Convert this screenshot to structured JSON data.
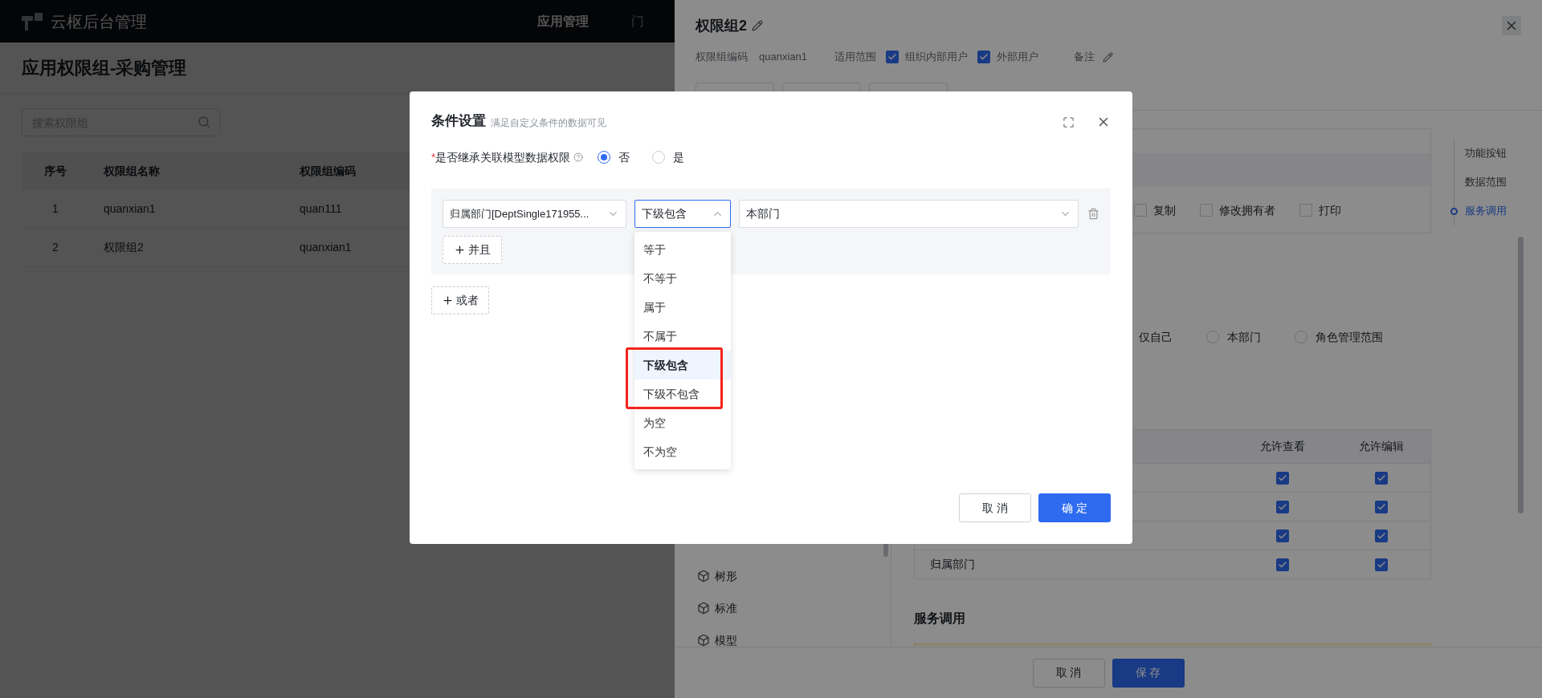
{
  "top_bar": {
    "title": "云枢后台管理",
    "nav": [
      {
        "label": "应用管理",
        "selected": true
      },
      {
        "label": "门",
        "selected": false
      }
    ]
  },
  "page": {
    "title": "应用权限组-采购管理",
    "search": {
      "placeholder": "搜索权限组"
    },
    "table": {
      "columns": [
        "序号",
        "权限组名称",
        "权限组编码"
      ],
      "rows": [
        [
          "1",
          "quanxian1",
          "quan111"
        ],
        [
          "2",
          "权限组2",
          "quanxian1"
        ]
      ]
    }
  },
  "drawer": {
    "title": "权限组2",
    "meta": {
      "code_label": "权限组编码",
      "code_value": "quanxian1",
      "scope_label": "适用范围",
      "scopes": [
        {
          "label": "组织内部用户",
          "checked": true
        },
        {
          "label": "外部用户",
          "checked": true
        }
      ],
      "remark_label": "备注"
    },
    "function_buttons": [
      {
        "label": "复制",
        "checked": false
      },
      {
        "label": "修改拥有者",
        "checked": false
      },
      {
        "label": "打印",
        "checked": false
      }
    ],
    "data_scope": [
      {
        "label": "仅自己"
      },
      {
        "label": "本部门",
        "selected": false
      },
      {
        "label": "角色管理范围",
        "selected": false
      }
    ],
    "field_table": {
      "columns": [
        "允许查看",
        "允许编辑"
      ],
      "rows": [
        {
          "view": true,
          "edit": true
        },
        {
          "view": true,
          "edit": true
        },
        {
          "view": true,
          "edit": true
        },
        {
          "label": "归属部门",
          "view": true,
          "edit": true
        }
      ]
    },
    "service_heading": "服务调用",
    "anchors": [
      {
        "label": "功能按钮",
        "selected": false
      },
      {
        "label": "数据范围",
        "selected": false
      },
      {
        "label": "服务调用",
        "selected": true
      }
    ],
    "sidebar": [
      {
        "label": "树形"
      },
      {
        "label": "标准"
      },
      {
        "label": "模型"
      }
    ],
    "footer": {
      "cancel": "取 消",
      "save": "保 存"
    }
  },
  "modal": {
    "title": "条件设置",
    "subtitle": "满足自定义条件的数据可见",
    "inherit": {
      "label": "是否继承关联模型数据权限",
      "required_mark": "*",
      "options": [
        {
          "label": "否",
          "selected": true
        },
        {
          "label": "是",
          "selected": false
        }
      ]
    },
    "condition": {
      "field": "归属部门[DeptSingle171955...",
      "operator": "下级包含",
      "value": "本部门",
      "operator_open": true
    },
    "and_button": "并且",
    "or_button": "或者",
    "operator_options": [
      {
        "label": "等于",
        "selected": false
      },
      {
        "label": "不等于",
        "selected": false
      },
      {
        "label": "属于",
        "selected": false
      },
      {
        "label": "不属于",
        "selected": false
      },
      {
        "label": "下级包含",
        "selected": true
      },
      {
        "label": "下级不包含",
        "selected": false
      },
      {
        "label": "为空",
        "selected": false
      },
      {
        "label": "不为空",
        "selected": false
      }
    ],
    "buttons": {
      "cancel": "取 消",
      "ok": "确 定"
    }
  }
}
